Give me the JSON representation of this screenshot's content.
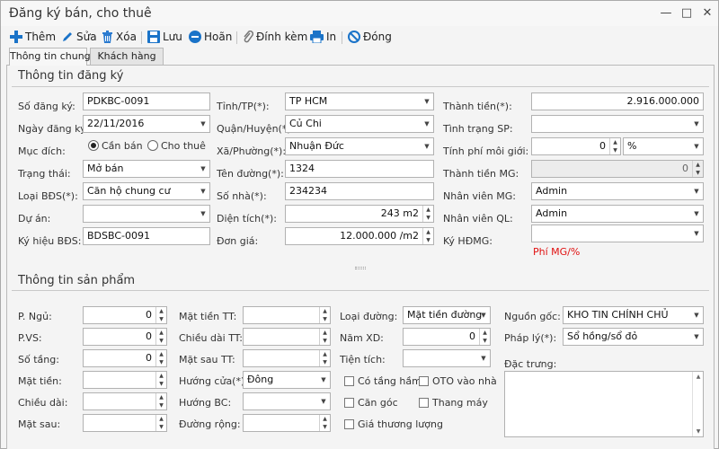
{
  "window": {
    "title": "Đăng ký bán, cho thuê",
    "minimize": "—",
    "maximize": "□",
    "close": "✕"
  },
  "toolbar": {
    "add": "Thêm",
    "edit": "Sửa",
    "delete": "Xóa",
    "save": "Lưu",
    "cancel": "Hoãn",
    "attach": "Đính kèm",
    "print": "In",
    "close": "Đóng"
  },
  "tabs": [
    "Thông tin chung",
    "Khách hàng"
  ],
  "registration": {
    "heading": "Thông tin đăng ký",
    "so_dang_ky": {
      "label": "Số đăng ký:",
      "value": "PDKBC-0091"
    },
    "ngay_dang_ky": {
      "label": "Ngày đăng ký:",
      "value": "22/11/2016"
    },
    "muc_dich": {
      "label": "Mục đích:",
      "opt1": "Cần bán",
      "opt2": "Cho thuê"
    },
    "trang_thai": {
      "label": "Trạng thái:",
      "value": "Mở bán"
    },
    "loai_bds": {
      "label": "Loại BĐS(*):",
      "value": "Căn hộ chung cư"
    },
    "du_an": {
      "label": "Dự án:",
      "value": ""
    },
    "ky_hieu_bds": {
      "label": "Ký hiệu BĐS:",
      "value": "BDSBC-0091"
    },
    "tinh_tp": {
      "label": "Tỉnh/TP(*):",
      "value": "TP HCM"
    },
    "quan_huyen": {
      "label": "Quận/Huyện(*):",
      "value": "Củ Chi"
    },
    "xa_phuong": {
      "label": "Xã/Phường(*):",
      "value": "Nhuận Đức"
    },
    "ten_duong": {
      "label": "Tên đường(*):",
      "value": "1324"
    },
    "so_nha": {
      "label": "Số nhà(*):",
      "value": "234234"
    },
    "dien_tich": {
      "label": "Diện tích(*):",
      "value": "243 m2"
    },
    "don_gia": {
      "label": "Đơn giá:",
      "value": "12.000.000 /m2"
    },
    "thanh_tien": {
      "label": "Thành tiền(*):",
      "value": "2.916.000.000"
    },
    "tinh_trang_sp": {
      "label": "Tình trạng SP:",
      "value": ""
    },
    "tinh_phi_moi_gioi": {
      "label": "Tính phí môi giới:",
      "value": "0",
      "unit": "%"
    },
    "thanh_tien_mg": {
      "label": "Thành tiền MG:",
      "value": "0"
    },
    "nhan_vien_mg": {
      "label": "Nhân viên MG:",
      "value": "Admin"
    },
    "nhan_vien_ql": {
      "label": "Nhân viên QL:",
      "value": "Admin"
    },
    "ky_hdmg": {
      "label": "Ký HĐMG:",
      "value": ""
    },
    "phi_note": "Phí MG/%"
  },
  "product": {
    "heading": "Thông tin sản phẩm",
    "p_ngu": {
      "label": "P. Ngủ:",
      "value": "0"
    },
    "p_vs": {
      "label": "P.VS:",
      "value": "0"
    },
    "so_tang": {
      "label": "Số tầng:",
      "value": "0"
    },
    "mat_tien": {
      "label": "Mặt tiền:",
      "value": ""
    },
    "chieu_dai": {
      "label": "Chiều dài:",
      "value": ""
    },
    "mat_sau": {
      "label": "Mặt sau:",
      "value": ""
    },
    "mat_tien_tt": {
      "label": "Mặt tiền TT:",
      "value": ""
    },
    "chieu_dai_tt": {
      "label": "Chiều dài TT:",
      "value": ""
    },
    "mat_sau_tt": {
      "label": "Mặt sau TT:",
      "value": ""
    },
    "huong_cua": {
      "label": "Hướng cửa(*):",
      "value": "Đông"
    },
    "huong_bc": {
      "label": "Hướng BC:",
      "value": ""
    },
    "duong_rong": {
      "label": "Đường rộng:",
      "value": ""
    },
    "loai_duong": {
      "label": "Loại đường:",
      "value": "Mặt tiền đường"
    },
    "nam_xd": {
      "label": "Năm XD:",
      "value": "0"
    },
    "tien_tich": {
      "label": "Tiện tích:",
      "value": ""
    },
    "co_tang_ham": "Có tầng hầm",
    "oto_vao_nha": "OTO vào nhà",
    "can_goc": "Căn góc",
    "thang_may": "Thang máy",
    "gia_thuong_luong": "Giá thương lượng",
    "nguon_goc": {
      "label": "Nguồn gốc:",
      "value": "KHO TIN CHÍNH CHỦ"
    },
    "phap_ly": {
      "label": "Pháp lý(*):",
      "value": "Sổ hồng/sổ đỏ"
    },
    "dac_trung": {
      "label": "Đặc trưng:"
    }
  },
  "colors": {
    "accent": "#1a73c8",
    "delete": "#2b7bd0",
    "required_note": "#e01010"
  }
}
